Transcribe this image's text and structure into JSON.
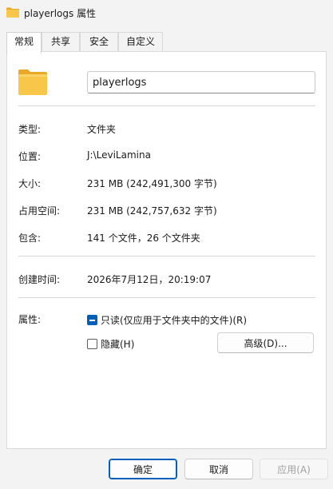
{
  "window": {
    "title": "playerlogs 属性",
    "icon": "folder-icon"
  },
  "tabs": [
    {
      "label": "常规",
      "active": true
    },
    {
      "label": "共享",
      "active": false
    },
    {
      "label": "安全",
      "active": false
    },
    {
      "label": "自定义",
      "active": false
    }
  ],
  "general": {
    "name_value": "playerlogs",
    "type_label": "类型:",
    "type_value": "文件夹",
    "location_label": "位置:",
    "location_value": "J:\\LeviLamina",
    "size_label": "大小:",
    "size_value": "231 MB (242,491,300 字节)",
    "disk_size_label": "占用空间:",
    "disk_size_value": "231 MB (242,757,632 字节)",
    "contains_label": "包含:",
    "contains_value": "141 个文件，26 个文件夹",
    "created_label": "创建时间:",
    "created_value": "2026年7月12日，20:19:07",
    "attributes_label": "属性:",
    "readonly_label": "只读(仅应用于文件夹中的文件)(R)",
    "hidden_label": "隐藏(H)",
    "advanced_button": "高级(D)..."
  },
  "footer": {
    "ok": "确定",
    "cancel": "取消",
    "apply": "应用(A)"
  },
  "colors": {
    "folder_yellow": "#f8c74a",
    "folder_shadow": "#e9a825",
    "accent": "#005fb8"
  }
}
